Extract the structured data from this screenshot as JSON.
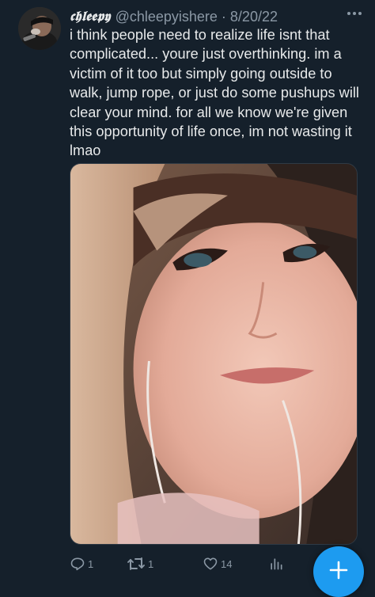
{
  "tweet": {
    "display_name": "𝖈𝖍𝖑𝖊𝖊𝖕𝖞",
    "handle": "@chleepyishere",
    "separator": "·",
    "date": "8/20/22",
    "text": "i think people need to realize life isnt that complicated... youre just overthinking. im a victim of it too but simply going outside to walk, jump rope, or just do some pushups will clear your mind. for all we know we're given this opportunity of life once, im not wasting it lmao",
    "media_icon": "photo",
    "avatar_icon": "avatar"
  },
  "actions": {
    "reply": {
      "icon": "reply-icon",
      "count": "1"
    },
    "retweet": {
      "icon": "retweet-icon",
      "count": "1"
    },
    "like": {
      "icon": "heart-icon",
      "count": "14"
    },
    "views": {
      "icon": "views-icon"
    }
  },
  "compose": {
    "icon": "plus-icon"
  },
  "colors": {
    "background": "#15202b",
    "text": "#e7e9ea",
    "muted": "#8b98a5",
    "accent": "#1d9bf0"
  }
}
